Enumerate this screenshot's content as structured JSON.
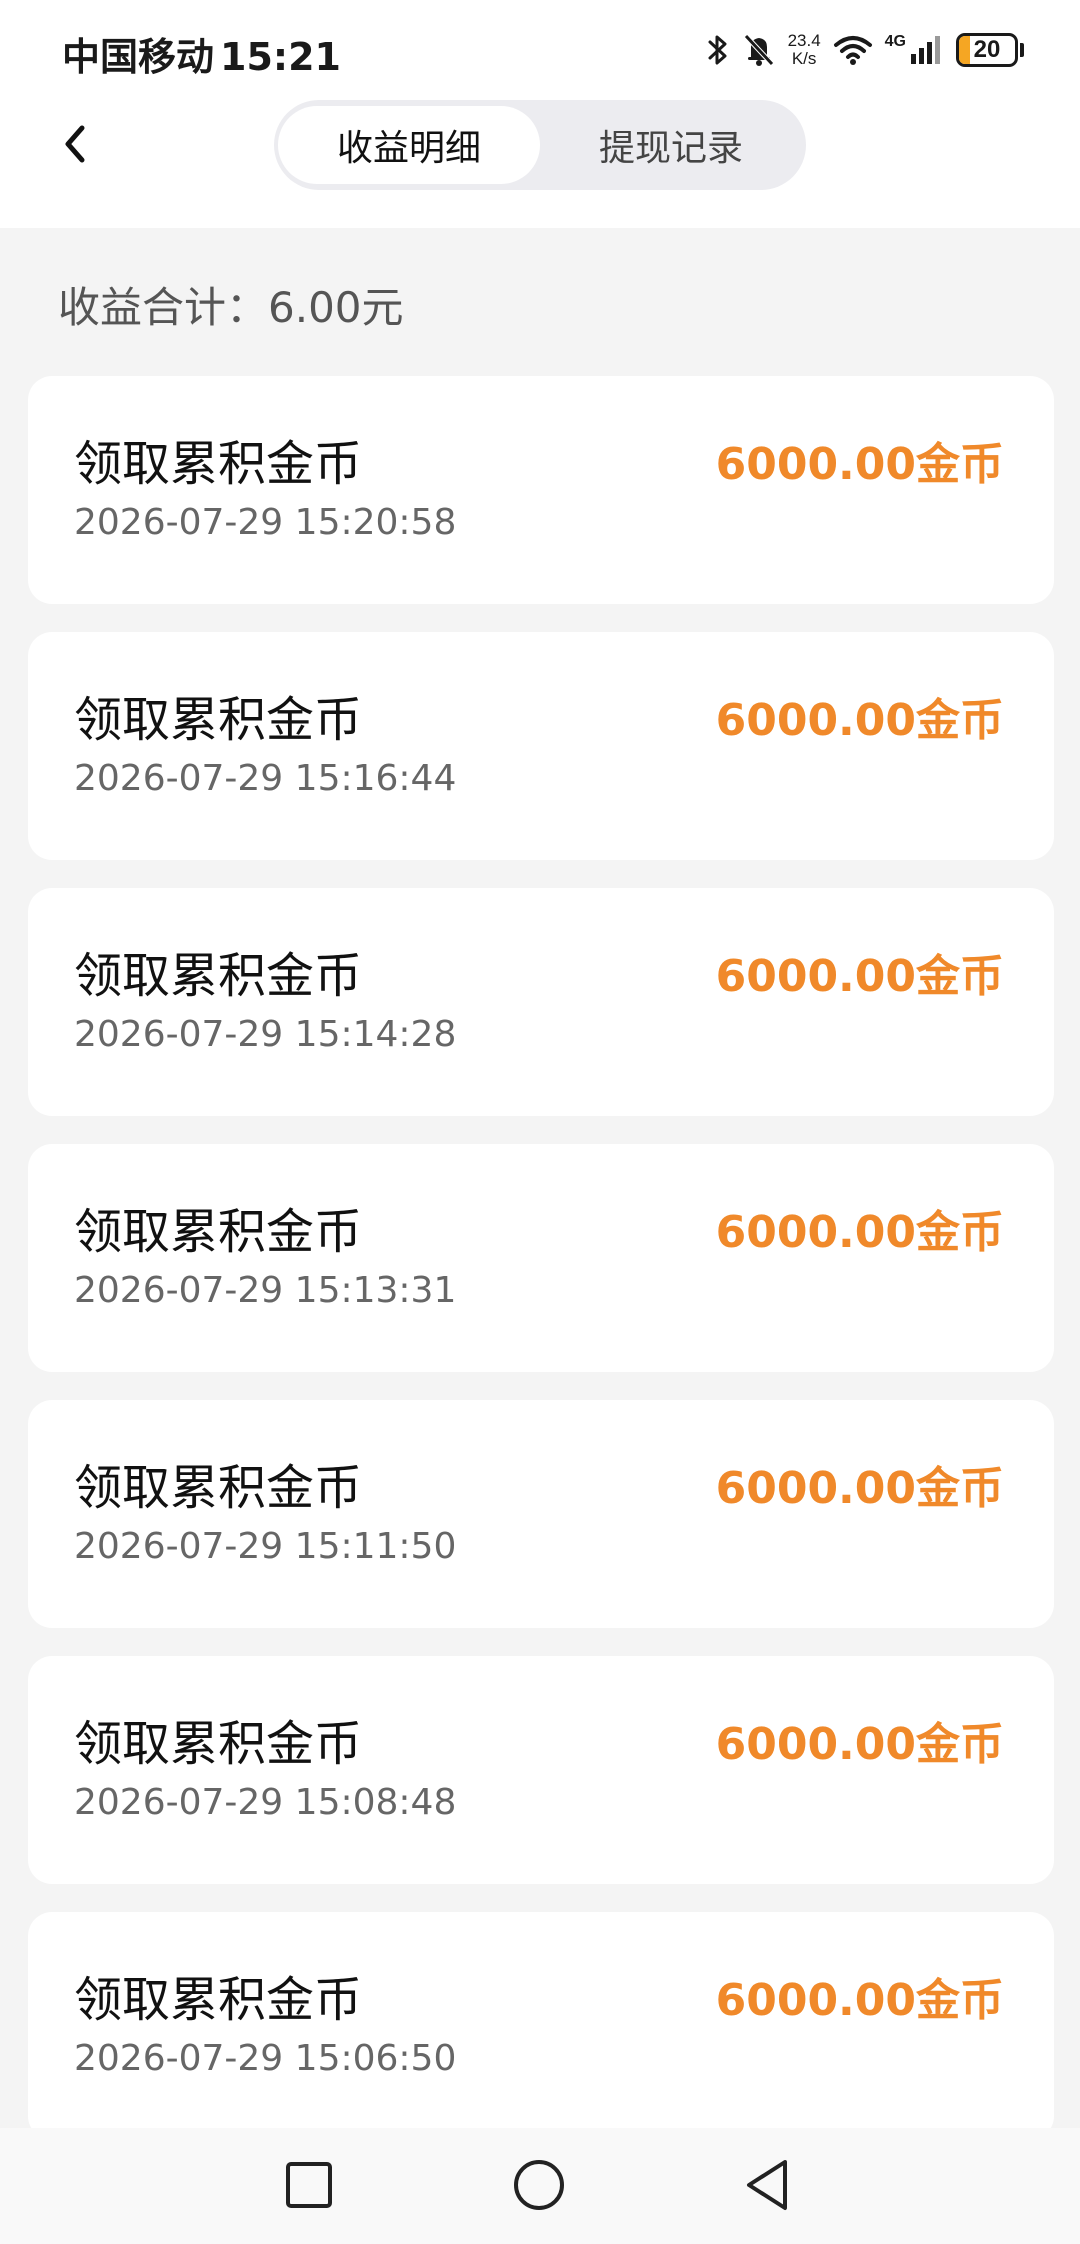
{
  "status_bar": {
    "carrier": "中国移动",
    "time": "15:21",
    "net_speed_value": "23.4",
    "net_speed_unit": "K/s",
    "network_type": "4G",
    "battery_level": "20",
    "battery_fraction": 0.2,
    "icons": [
      "bluetooth-icon",
      "mute-icon",
      "wifi-icon",
      "signal-icon",
      "battery-icon"
    ]
  },
  "header": {
    "back_icon": "chevron-left-icon",
    "tabs": [
      {
        "label": "收益明细",
        "active": true
      },
      {
        "label": "提现记录",
        "active": false
      }
    ]
  },
  "summary": {
    "label": "收益合计：",
    "value": "6.00元"
  },
  "records": [
    {
      "title": "领取累积金币",
      "time": "2026-07-29 15:20:58",
      "amount": "6000.00金币"
    },
    {
      "title": "领取累积金币",
      "time": "2026-07-29 15:16:44",
      "amount": "6000.00金币"
    },
    {
      "title": "领取累积金币",
      "time": "2026-07-29 15:14:28",
      "amount": "6000.00金币"
    },
    {
      "title": "领取累积金币",
      "time": "2026-07-29 15:13:31",
      "amount": "6000.00金币"
    },
    {
      "title": "领取累积金币",
      "time": "2026-07-29 15:11:50",
      "amount": "6000.00金币"
    },
    {
      "title": "领取累积金币",
      "time": "2026-07-29 15:08:48",
      "amount": "6000.00金币"
    },
    {
      "title": "领取累积金币",
      "time": "2026-07-29 15:06:50",
      "amount": "6000.00金币"
    }
  ],
  "colors": {
    "accent": "#f0892a",
    "background": "#f4f4f4",
    "card": "#ffffff"
  },
  "nav_bar": {
    "icons": [
      "recents-icon",
      "home-icon",
      "back-triangle-icon"
    ]
  }
}
